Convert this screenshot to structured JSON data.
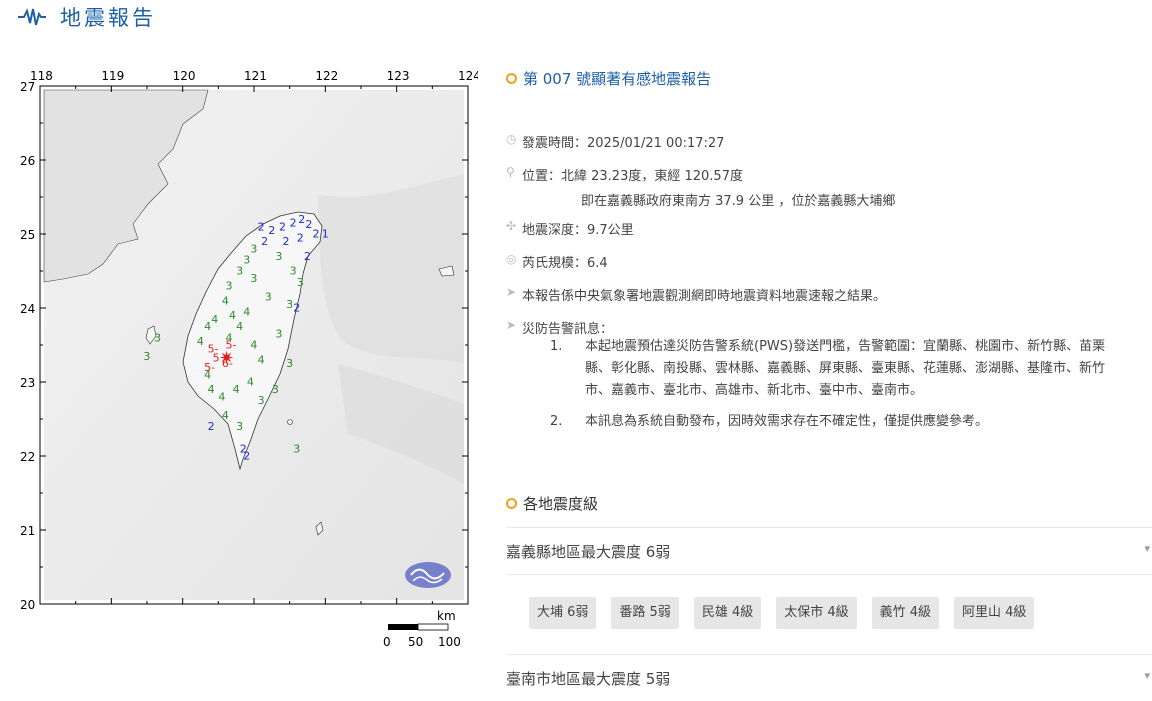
{
  "page": {
    "title": "地震報告"
  },
  "map": {
    "lon_labels": [
      "118",
      "119",
      "120",
      "121",
      "122",
      "123",
      "124"
    ],
    "lat_labels": [
      "27",
      "26",
      "25",
      "24",
      "23",
      "22",
      "21",
      "20"
    ],
    "scale_unit": "km",
    "scale_labels": [
      "0",
      "50",
      "100"
    ],
    "intensity_marks": [
      {
        "t": "1",
        "c": "#1a2ec8",
        "lon": 121.95,
        "lat": 24.95
      },
      {
        "t": "2",
        "c": "#1a2ec8",
        "lon": 121.05,
        "lat": 25.05
      },
      {
        "t": "2",
        "c": "#1a2ec8",
        "lon": 121.2,
        "lat": 25.0
      },
      {
        "t": "2",
        "c": "#1a2ec8",
        "lon": 121.35,
        "lat": 25.05
      },
      {
        "t": "2",
        "c": "#1a2ec8",
        "lon": 121.5,
        "lat": 25.1
      },
      {
        "t": "2",
        "c": "#1a2ec8",
        "lon": 121.62,
        "lat": 25.15
      },
      {
        "t": "2",
        "c": "#1a2ec8",
        "lon": 121.72,
        "lat": 25.08
      },
      {
        "t": "2",
        "c": "#1a2ec8",
        "lon": 121.82,
        "lat": 24.95
      },
      {
        "t": "2",
        "c": "#1a2ec8",
        "lon": 121.6,
        "lat": 24.9
      },
      {
        "t": "2",
        "c": "#1a2ec8",
        "lon": 121.4,
        "lat": 24.85
      },
      {
        "t": "2",
        "c": "#1a2ec8",
        "lon": 121.1,
        "lat": 24.85
      },
      {
        "t": "2",
        "c": "#1a2ec8",
        "lon": 121.7,
        "lat": 24.65
      },
      {
        "t": "2",
        "c": "#1a2ec8",
        "lon": 121.55,
        "lat": 23.95
      },
      {
        "t": "2",
        "c": "#1a2ec8",
        "lon": 120.35,
        "lat": 22.35
      },
      {
        "t": "2",
        "c": "#1a2ec8",
        "lon": 120.8,
        "lat": 22.05
      },
      {
        "t": "2",
        "c": "#1a2ec8",
        "lon": 120.85,
        "lat": 21.95
      },
      {
        "t": "3",
        "c": "#2a8a2a",
        "lon": 120.95,
        "lat": 24.75
      },
      {
        "t": "3",
        "c": "#2a8a2a",
        "lon": 120.85,
        "lat": 24.6
      },
      {
        "t": "3",
        "c": "#2a8a2a",
        "lon": 120.75,
        "lat": 24.45
      },
      {
        "t": "3",
        "c": "#2a8a2a",
        "lon": 121.3,
        "lat": 24.65
      },
      {
        "t": "3",
        "c": "#2a8a2a",
        "lon": 121.5,
        "lat": 24.45
      },
      {
        "t": "3",
        "c": "#2a8a2a",
        "lon": 121.6,
        "lat": 24.3
      },
      {
        "t": "3",
        "c": "#2a8a2a",
        "lon": 121.45,
        "lat": 24.0
      },
      {
        "t": "3",
        "c": "#2a8a2a",
        "lon": 121.3,
        "lat": 23.6
      },
      {
        "t": "3",
        "c": "#2a8a2a",
        "lon": 121.45,
        "lat": 23.2
      },
      {
        "t": "3",
        "c": "#2a8a2a",
        "lon": 121.25,
        "lat": 22.85
      },
      {
        "t": "3",
        "c": "#2a8a2a",
        "lon": 121.05,
        "lat": 22.7
      },
      {
        "t": "3",
        "c": "#2a8a2a",
        "lon": 120.75,
        "lat": 22.35
      },
      {
        "t": "3",
        "c": "#2a8a2a",
        "lon": 121.55,
        "lat": 22.05
      },
      {
        "t": "3",
        "c": "#2a8a2a",
        "lon": 120.6,
        "lat": 24.25
      },
      {
        "t": "3",
        "c": "#2a8a2a",
        "lon": 119.6,
        "lat": 23.55
      },
      {
        "t": "3",
        "c": "#2a8a2a",
        "lon": 119.45,
        "lat": 23.3
      },
      {
        "t": "3",
        "c": "#2a8a2a",
        "lon": 120.95,
        "lat": 24.35
      },
      {
        "t": "3",
        "c": "#2a8a2a",
        "lon": 121.15,
        "lat": 24.1
      },
      {
        "t": "4",
        "c": "#2a8a2a",
        "lon": 120.55,
        "lat": 24.05
      },
      {
        "t": "4",
        "c": "#2a8a2a",
        "lon": 120.65,
        "lat": 23.85
      },
      {
        "t": "4",
        "c": "#2a8a2a",
        "lon": 120.4,
        "lat": 23.8
      },
      {
        "t": "4",
        "c": "#2a8a2a",
        "lon": 120.3,
        "lat": 23.7
      },
      {
        "t": "4",
        "c": "#2a8a2a",
        "lon": 120.85,
        "lat": 23.9
      },
      {
        "t": "4",
        "c": "#2a8a2a",
        "lon": 120.75,
        "lat": 23.7
      },
      {
        "t": "4",
        "c": "#2a8a2a",
        "lon": 120.6,
        "lat": 23.55
      },
      {
        "t": "4",
        "c": "#2a8a2a",
        "lon": 120.95,
        "lat": 23.45
      },
      {
        "t": "4",
        "c": "#2a8a2a",
        "lon": 121.05,
        "lat": 23.25
      },
      {
        "t": "4",
        "c": "#2a8a2a",
        "lon": 120.3,
        "lat": 23.05
      },
      {
        "t": "4",
        "c": "#2a8a2a",
        "lon": 120.35,
        "lat": 22.85
      },
      {
        "t": "4",
        "c": "#2a8a2a",
        "lon": 120.5,
        "lat": 22.75
      },
      {
        "t": "4",
        "c": "#2a8a2a",
        "lon": 120.7,
        "lat": 22.85
      },
      {
        "t": "4",
        "c": "#2a8a2a",
        "lon": 120.9,
        "lat": 22.95
      },
      {
        "t": "4",
        "c": "#2a8a2a",
        "lon": 120.55,
        "lat": 22.5
      },
      {
        "t": "4",
        "c": "#2a8a2a",
        "lon": 120.2,
        "lat": 23.5
      },
      {
        "t": "5-",
        "c": "#e02020",
        "lon": 120.35,
        "lat": 23.4
      },
      {
        "t": "5-",
        "c": "#e02020",
        "lon": 120.6,
        "lat": 23.45
      },
      {
        "t": "5-",
        "c": "#e02020",
        "lon": 120.3,
        "lat": 23.15
      },
      {
        "t": "6-",
        "c": "#e02020",
        "lon": 120.55,
        "lat": 23.2
      },
      {
        "t": "5",
        "c": "#e02020",
        "lon": 120.42,
        "lat": 23.28
      }
    ]
  },
  "report": {
    "title": "第 007 號顯著有感地震報告",
    "time_label": "發震時間：2025/01/21 00:17:27",
    "location_label": "位置：北緯 23.23度，東經 120.57度",
    "location_sub": "即在嘉義縣政府東南方 37.9 公里 ，位於嘉義縣大埔鄉",
    "depth_label": "地震深度：9.7公里",
    "magnitude_label": "芮氏規模：6.4",
    "note": "本報告係中央氣象署地震觀測網即時地震資料地震速報之結果。",
    "warn_title": "災防告警訊息：",
    "warn_items": [
      {
        "num": "1.",
        "lines": [
          "本起地震預估達災防告警系統(PWS)發送門檻，告警範圍：宜蘭縣、桃園市、新竹縣、苗栗",
          "縣、彰化縣、南投縣、雲林縣、嘉義縣、屏東縣、臺東縣、花蓮縣、澎湖縣、基隆市、新竹",
          "市、嘉義市、臺北市、高雄市、新北市、臺中市、臺南市。"
        ]
      },
      {
        "num": "2.",
        "lines": [
          "本訊息為系統自動發布，因時效需求存在不確定性，僅提供應變參考。"
        ]
      }
    ]
  },
  "intensity_section": {
    "title": "各地震度級",
    "regions": [
      {
        "label": "嘉義縣地區最大震度 6弱",
        "stations": [
          "大埔 6弱",
          "番路 5弱",
          "民雄 4級",
          "太保市 4級",
          "義竹 4級",
          "阿里山 4級"
        ]
      },
      {
        "label": "臺南市地區最大震度 5弱"
      }
    ]
  },
  "colors": {
    "brand": "#1e5fa8",
    "accent": "#f0a020"
  }
}
